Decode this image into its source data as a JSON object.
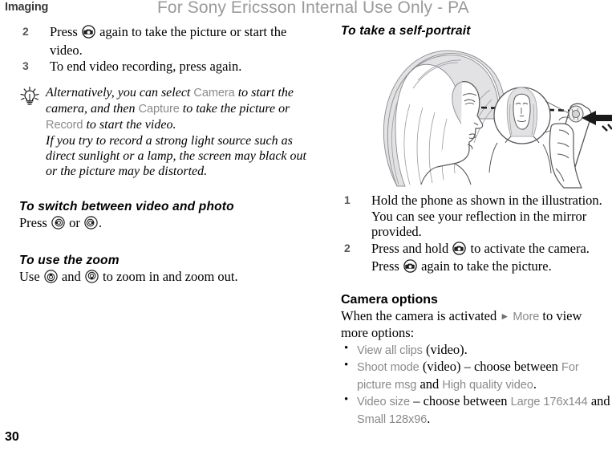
{
  "header": {
    "chapter": "Imaging",
    "watermark": "For Sony Ericsson Internal Use Only - PA"
  },
  "page_number": "30",
  "left_column": {
    "procedure": [
      {
        "number": "2",
        "text_before_icon": "Press ",
        "icon": "camera-key-icon",
        "text_after_icon": " again to take the picture or start the video."
      },
      {
        "number": "3",
        "text_before_icon": "To end video recording, press again.",
        "icon": "",
        "text_after_icon": ""
      }
    ],
    "tip": {
      "icon": "lightbulb-tip-icon",
      "part1": "Alternatively, you can select ",
      "term1": "Camera",
      "part2": " to start the camera, and then ",
      "term2": "Capture",
      "part3": " to take the picture or ",
      "term3": "Record",
      "part4": " to start the video.",
      "part5": "If you try to record a strong light source such as direct sunlight or a lamp, the screen may black out or the picture may be distorted."
    },
    "section_switch": {
      "heading": "To switch between video and photo",
      "text_before": "Press ",
      "icon_left": "nav-key-left-icon",
      "text_middle": " or ",
      "icon_right": "nav-key-right-icon",
      "text_after": "."
    },
    "section_zoom": {
      "heading": "To use the zoom",
      "text_before": "Use ",
      "icon_up": "nav-key-up-icon",
      "text_middle": " and ",
      "icon_down": "nav-key-down-icon",
      "text_after": " to zoom in and zoom out."
    }
  },
  "right_column": {
    "heading": "To take a self-portrait",
    "illustration": {
      "alt": "Woman in profile viewing her reflection in the phone's mirror while a hand holds the phone",
      "callout": "mirror-magnifier-circle",
      "arrow": "press-camera-button-arrow"
    },
    "procedure": [
      {
        "number": "1",
        "text_before_icon": "Hold the phone as shown in the illustration. You can see your reflection in the mirror provided.",
        "icon": "",
        "text_after_icon": ""
      },
      {
        "number": "2",
        "text_before_icon": "Press and hold ",
        "icon": "camera-key-icon",
        "text_middle": " to activate the camera. Press ",
        "icon2": "camera-key-icon",
        "text_after_icon": " again to take the picture."
      }
    ],
    "camera_options": {
      "heading": "Camera options",
      "intro_part1": "When the camera is activated ",
      "intro_arrow": "►",
      "intro_term": "More",
      "intro_part2": " to view more options:",
      "bullets": [
        {
          "term1": "View all clips",
          "text1": " (video)."
        },
        {
          "term1": "Shoot mode",
          "text1": " (video) – choose between ",
          "term2": "For picture msg",
          "text2": " and ",
          "term3": "High quality video",
          "text3": "."
        },
        {
          "term1": "Video size",
          "text1": " – choose between ",
          "term2": "Large 176x144",
          "text2": " and ",
          "term3": "Small 128x96",
          "text3": "."
        }
      ]
    }
  },
  "colors": {
    "ui_term_gray": "#8a8a8c",
    "watermark_gray": "#9a9a9a",
    "list_number_gray": "#58585a",
    "hair_fill": "#e2e2e4",
    "line_stroke": "#58585a"
  }
}
